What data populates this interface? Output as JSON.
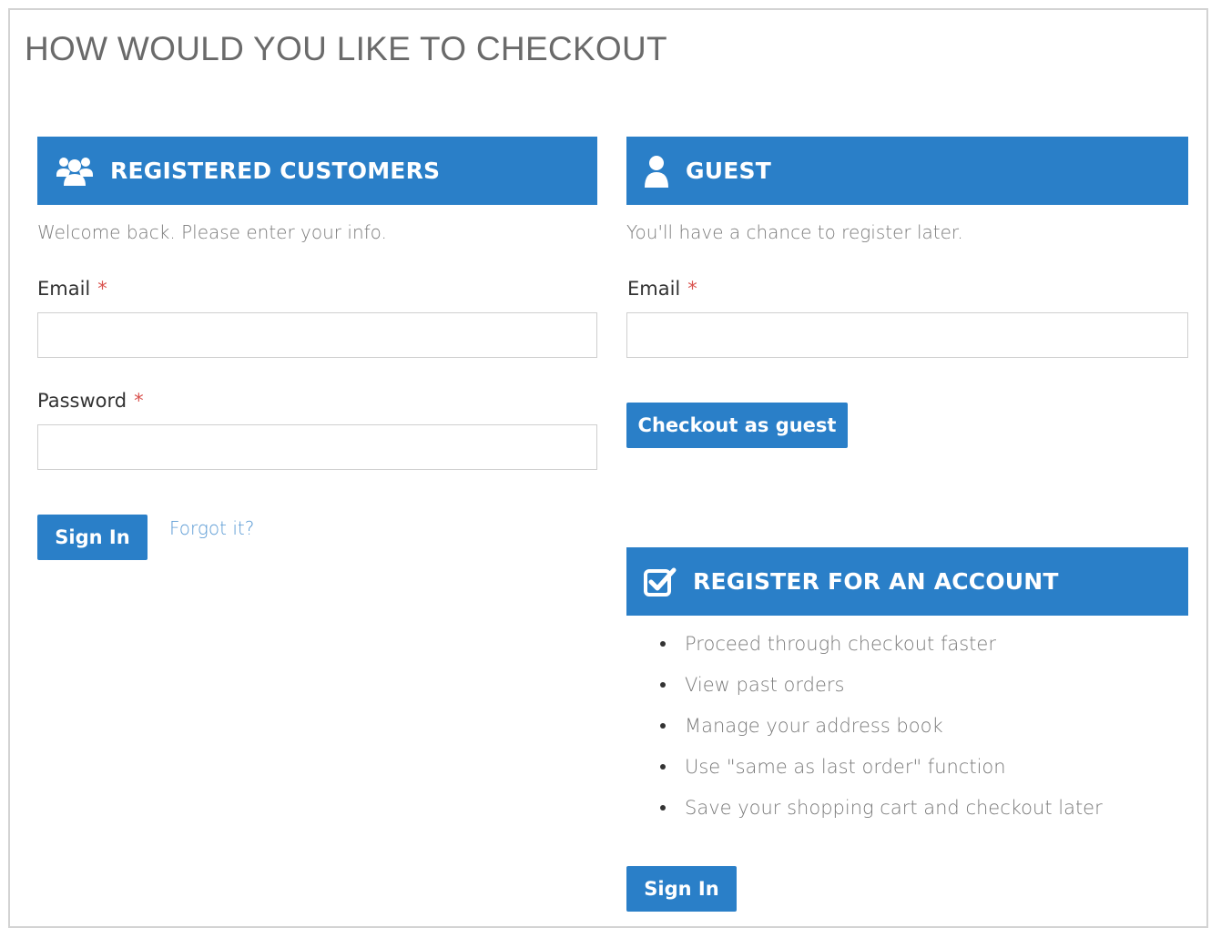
{
  "page": {
    "title": "HOW WOULD YOU LIKE TO CHECKOUT"
  },
  "registered": {
    "header": "REGISTERED CUSTOMERS",
    "icon": "users-icon",
    "hint": "Welcome back. Please enter your info.",
    "email_label": "Email",
    "email_value": "",
    "password_label": "Password",
    "password_value": "",
    "required_mark": "*",
    "sign_in_label": "Sign In",
    "forgot_label": "Forgot it?"
  },
  "guest": {
    "header": "GUEST",
    "icon": "user-icon",
    "hint": "You'll have a chance to register later.",
    "email_label": "Email",
    "email_value": "",
    "required_mark": "*",
    "checkout_label": "Checkout as guest"
  },
  "register": {
    "header": "REGISTER FOR AN ACCOUNT",
    "icon": "checkbox-icon",
    "benefits": [
      "Proceed through checkout faster",
      "View past orders",
      "Manage your address book",
      "Use \"same as last order\" function",
      "Save your shopping cart and checkout later"
    ],
    "sign_in_label": "Sign In"
  },
  "colors": {
    "accent": "#2a7fc8",
    "required": "#d9534f",
    "link": "#5a9ad4",
    "muted_text": "#7a7a7a"
  }
}
